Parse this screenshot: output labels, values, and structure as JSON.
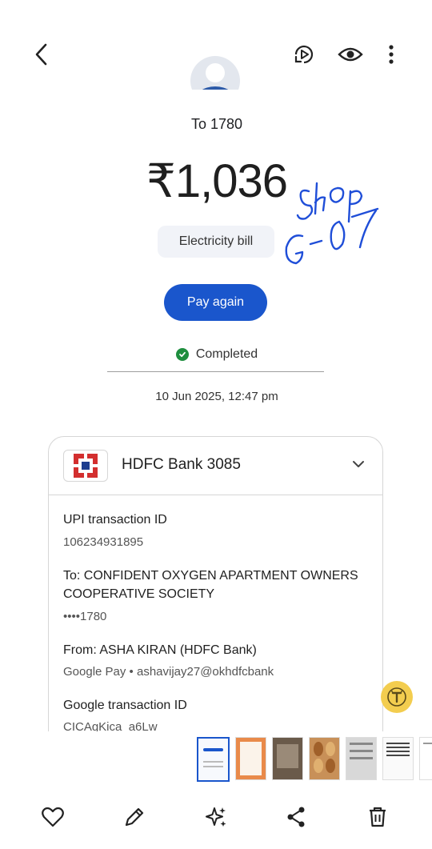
{
  "topbar": {
    "back_icon": "chevron-left-icon",
    "motion_icon": "motion-photo-icon",
    "view_icon": "eye-icon",
    "more_icon": "more-vertical-icon"
  },
  "payment": {
    "recipient": "To 1780",
    "amount": "₹1,036",
    "note": "Electricity bill",
    "pay_again": "Pay again",
    "status": "Completed",
    "datetime": "10 Jun 2025, 12:47 pm"
  },
  "bank": {
    "name": "HDFC Bank 3085",
    "upi_label": "UPI transaction ID",
    "upi_id": "106234931895",
    "to_label": "To: CONFIDENT OXYGEN APARTMENT OWNERS COOPERATIVE SOCIETY",
    "to_account": "••••1780",
    "from_label": "From: ASHA KIRAN (HDFC Bank)",
    "from_value": "Google Pay • ashavijay27@okhdfcbank",
    "gtid_label": "Google transaction ID",
    "gtid_value": "CICAgKica_a6Lw"
  },
  "annotation": {
    "line1": "shop",
    "line2": "G-07",
    "color": "#1f4ed8"
  },
  "colors": {
    "accent": "#1a56cc",
    "success": "#1e8e3e",
    "hdfc_red": "#d32f2f",
    "hdfc_blue": "#1c3d8f"
  },
  "bottombar": {
    "favorite_icon": "heart-icon",
    "edit_icon": "pencil-icon",
    "ai_icon": "sparkle-icon",
    "share_icon": "share-icon",
    "delete_icon": "trash-icon"
  }
}
